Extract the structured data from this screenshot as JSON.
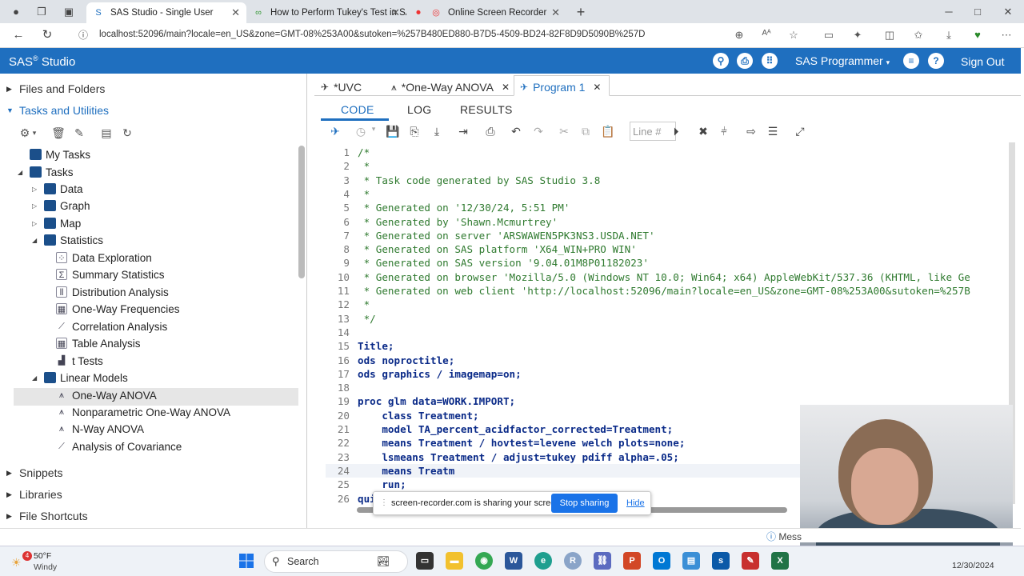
{
  "browser": {
    "tabs": [
      {
        "title": "SAS Studio - Single User",
        "active": true
      },
      {
        "title": "How to Perform Tukey's Test in SAS",
        "active": false
      },
      {
        "title": "Online Screen Recorder",
        "active": false
      }
    ],
    "url": "localhost:52096/main?locale=en_US&zone=GMT-08%253A00&sutoken=%257B480ED880-B7D5-4509-BD24-82F8D9D5090B%257D"
  },
  "sas": {
    "title_main": "SAS",
    "title_reg": "®",
    "title_rest": " Studio",
    "user_menu": "SAS Programmer",
    "sign_out": "Sign Out"
  },
  "left": {
    "sections": {
      "files": "Files and Folders",
      "tasks": "Tasks and Utilities",
      "snippets": "Snippets",
      "libraries": "Libraries",
      "shortcuts": "File Shortcuts"
    },
    "tree": {
      "my_tasks": "My Tasks",
      "tasks": "Tasks",
      "data": "Data",
      "graph": "Graph",
      "map": "Map",
      "statistics": "Statistics",
      "data_exploration": "Data Exploration",
      "summary_statistics": "Summary Statistics",
      "distribution_analysis": "Distribution Analysis",
      "one_way_frequencies": "One-Way Frequencies",
      "correlation_analysis": "Correlation Analysis",
      "table_analysis": "Table Analysis",
      "t_tests": "t Tests",
      "linear_models": "Linear Models",
      "one_way_anova": "One-Way ANOVA",
      "nonparametric": "Nonparametric One-Way ANOVA",
      "n_way_anova": "N-Way ANOVA",
      "ancova": "Analysis of Covariance"
    }
  },
  "editor": {
    "tabs": [
      "*UVC",
      "*One-Way ANOVA",
      "Program 1"
    ],
    "subtabs": [
      "CODE",
      "LOG",
      "RESULTS"
    ],
    "line_placeholder": "Line #",
    "lines": [
      {
        "n": "1",
        "t": "/*"
      },
      {
        "n": "2",
        "t": " *"
      },
      {
        "n": "3",
        "t": " * Task code generated by SAS Studio 3.8"
      },
      {
        "n": "4",
        "t": " *"
      },
      {
        "n": "5",
        "t": " * Generated on '12/30/24, 5:51 PM'"
      },
      {
        "n": "6",
        "t": " * Generated by 'Shawn.Mcmurtrey'"
      },
      {
        "n": "7",
        "t": " * Generated on server 'ARSWAWEN5PK3NS3.USDA.NET'"
      },
      {
        "n": "8",
        "t": " * Generated on SAS platform 'X64_WIN+PRO WIN'"
      },
      {
        "n": "9",
        "t": " * Generated on SAS version '9.04.01M8P01182023'"
      },
      {
        "n": "10",
        "t": " * Generated on browser 'Mozilla/5.0 (Windows NT 10.0; Win64; x64) AppleWebKit/537.36 (KHTML, like Ge"
      },
      {
        "n": "11",
        "t": " * Generated on web client 'http://localhost:52096/main?locale=en_US&zone=GMT-08%253A00&sutoken=%257B"
      },
      {
        "n": "12",
        "t": " *"
      },
      {
        "n": "13",
        "t": " */"
      },
      {
        "n": "14",
        "t": ""
      },
      {
        "n": "15",
        "t": "Title;"
      },
      {
        "n": "16",
        "t": "ods noproctitle;"
      },
      {
        "n": "17",
        "t": "ods graphics / imagemap=on;"
      },
      {
        "n": "18",
        "t": ""
      },
      {
        "n": "19",
        "t": "proc glm data=WORK.IMPORT;"
      },
      {
        "n": "20",
        "t": "    class Treatment;"
      },
      {
        "n": "21",
        "t": "    model TA_percent_acidfactor_corrected=Treatment;"
      },
      {
        "n": "22",
        "t": "    means Treatment / hovtest=levene welch plots=none;"
      },
      {
        "n": "23",
        "t": "    lsmeans Treatment / adjust=tukey pdiff alpha=.05;"
      },
      {
        "n": "24",
        "t": "    means Treatm"
      },
      {
        "n": "25",
        "t": "    run;"
      },
      {
        "n": "26",
        "t": "qui"
      }
    ]
  },
  "sharing": {
    "message": "screen-recorder.com is sharing your screen.",
    "stop": "Stop sharing",
    "hide": "Hide"
  },
  "statusbar": {
    "messages": "Mess"
  },
  "taskbar": {
    "badge": "4",
    "temp": "50°F",
    "condition": "Windy",
    "search": "Search",
    "date": "12/30/2024"
  }
}
